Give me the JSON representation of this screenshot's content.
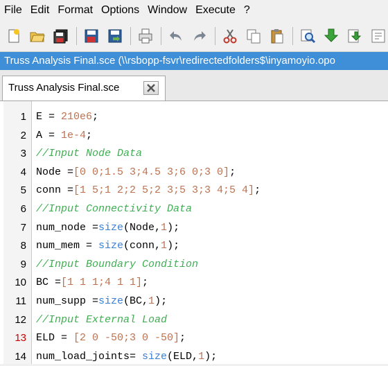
{
  "menu": [
    "File",
    "Edit",
    "Format",
    "Options",
    "Window",
    "Execute",
    "?"
  ],
  "toolbar_icons": [
    "new-file-icon",
    "open-file-icon",
    "save-all-icon",
    "save-icon",
    "save-as-icon",
    "print-icon",
    "undo-icon",
    "redo-icon",
    "cut-icon",
    "copy-icon",
    "paste-icon",
    "find-icon",
    "execute-icon",
    "load-icon"
  ],
  "window_title": "Truss Analysis Final.sce (\\\\rsbopp-fsvr\\redirectedfolders$\\inyamoyio.opo",
  "tab": {
    "label": "Truss Analysis Final.sce"
  },
  "colors": {
    "title_bar": "#3e8fd8",
    "number": "#bc7250",
    "comment": "#3fae53",
    "function": "#3a7fd5",
    "error_line": "#cc0000"
  },
  "editor": {
    "lines": [
      {
        "num": "1",
        "tokens": [
          [
            "t",
            "E = "
          ],
          [
            "n",
            "210e6"
          ],
          [
            "t",
            ";"
          ]
        ]
      },
      {
        "num": "2",
        "tokens": [
          [
            "t",
            "A = "
          ],
          [
            "n",
            "1e-4"
          ],
          [
            "t",
            ";"
          ]
        ]
      },
      {
        "num": "3",
        "tokens": [
          [
            "c",
            "//Input Node Data"
          ]
        ]
      },
      {
        "num": "4",
        "tokens": [
          [
            "t",
            "Node ="
          ],
          [
            "n",
            "[0 0;1.5 3;4.5 3;6 0;3 0]"
          ],
          [
            "t",
            ";"
          ]
        ]
      },
      {
        "num": "5",
        "tokens": [
          [
            "t",
            "conn ="
          ],
          [
            "n",
            "[1 5;1 2;2 5;2 3;5 3;3 4;5 4]"
          ],
          [
            "t",
            ";"
          ]
        ]
      },
      {
        "num": "6",
        "tokens": [
          [
            "c",
            "//Input Connectivity Data"
          ]
        ]
      },
      {
        "num": "7",
        "tokens": [
          [
            "t",
            "num_node ="
          ],
          [
            "f",
            "size"
          ],
          [
            "t",
            "(Node,"
          ],
          [
            "n",
            "1"
          ],
          [
            "t",
            ");"
          ]
        ]
      },
      {
        "num": "8",
        "tokens": [
          [
            "t",
            "num_mem = "
          ],
          [
            "f",
            "size"
          ],
          [
            "t",
            "(conn,"
          ],
          [
            "n",
            "1"
          ],
          [
            "t",
            ");"
          ]
        ]
      },
      {
        "num": "9",
        "tokens": [
          [
            "c",
            "//Input Boundary Condition"
          ]
        ]
      },
      {
        "num": "10",
        "tokens": [
          [
            "t",
            "BC ="
          ],
          [
            "n",
            "[1 1 1;4 1 1]"
          ],
          [
            "t",
            ";"
          ]
        ]
      },
      {
        "num": "11",
        "tokens": [
          [
            "t",
            "num_supp ="
          ],
          [
            "f",
            "size"
          ],
          [
            "t",
            "(BC,"
          ],
          [
            "n",
            "1"
          ],
          [
            "t",
            ");"
          ]
        ]
      },
      {
        "num": "12",
        "tokens": [
          [
            "c",
            "//Input External Load"
          ]
        ]
      },
      {
        "num": "13",
        "err": true,
        "tokens": [
          [
            "t",
            "ELD = "
          ],
          [
            "n",
            "[2 0 -50;3 0 -50]"
          ],
          [
            "t",
            ";"
          ]
        ]
      },
      {
        "num": "14",
        "tokens": [
          [
            "t",
            "num_load_joints= "
          ],
          [
            "f",
            "size"
          ],
          [
            "t",
            "(ELD,"
          ],
          [
            "n",
            "1"
          ],
          [
            "t",
            ");"
          ]
        ]
      }
    ]
  }
}
